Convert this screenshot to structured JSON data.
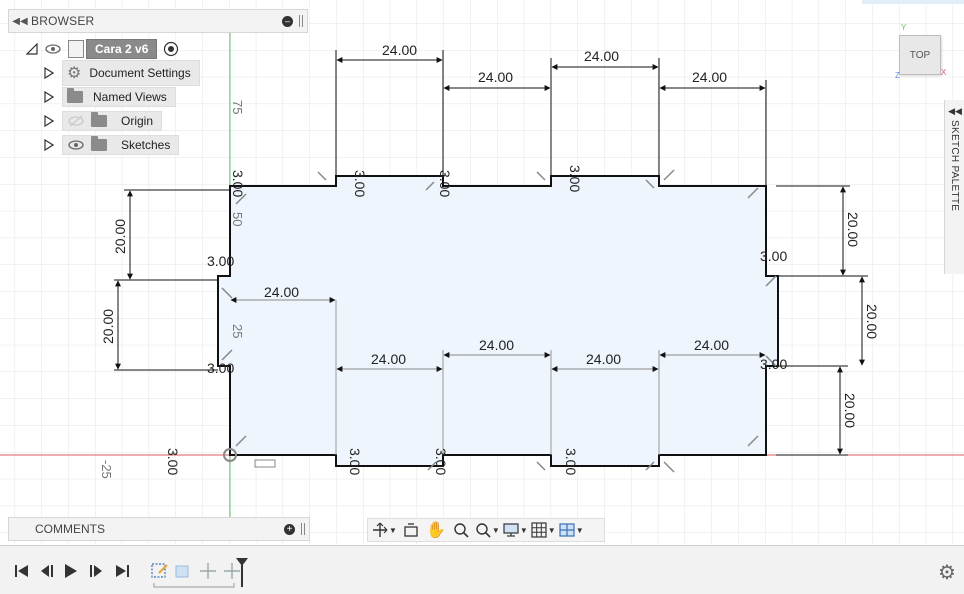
{
  "browser": {
    "title": "BROWSER",
    "root": {
      "label": "Cara 2 v6"
    },
    "items": [
      {
        "label": "Document Settings",
        "icon": "gear-icon"
      },
      {
        "label": "Named Views",
        "icon": "folder-icon"
      },
      {
        "label": "Origin",
        "icon": "folder-icon"
      },
      {
        "label": "Sketches",
        "icon": "folder-icon"
      }
    ]
  },
  "comments": {
    "title": "COMMENTS"
  },
  "viewcube": {
    "label": "TOP"
  },
  "palette": {
    "label": "SKETCH PALETTE"
  },
  "axis_labels": {
    "y75": "75",
    "y50": "50",
    "y25": "25",
    "xneg25": "-25"
  },
  "dimensions": {
    "top_row": [
      "24.00",
      "24.00",
      "24.00",
      "24.00"
    ],
    "inner_row": [
      "24.00",
      "24.00",
      "24.00",
      "24.00",
      "24.00"
    ],
    "left_vertical": [
      "20.00",
      "20.00"
    ],
    "right_vertical": [
      "20.00",
      "20.00",
      "20.00"
    ],
    "small": [
      "3.00",
      "3.00",
      "3.00",
      "3.00",
      "3.00",
      "3.00",
      "3.00",
      "3.00",
      "3.00",
      "3.00",
      "3.00",
      "3.00"
    ]
  },
  "colors": {
    "grid": "#e4e4e4",
    "profile_fill": "#eef5fc",
    "x_axis": "#e05a5a",
    "y_axis": "#69c269"
  }
}
